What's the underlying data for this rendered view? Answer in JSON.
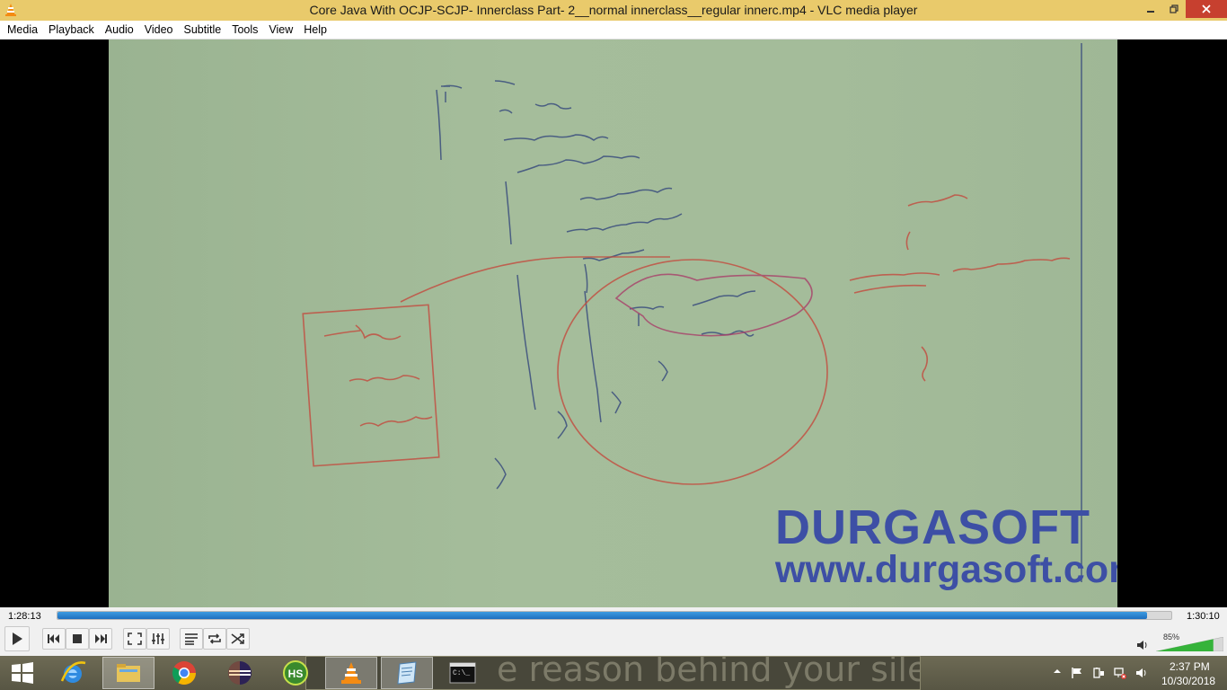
{
  "window": {
    "title": "Core Java With OCJP-SCJP- Innerclass  Part- 2__normal innerclass__regular innerc.mp4 - VLC media player",
    "controls": [
      "minimize-icon",
      "maximize-icon",
      "close-icon"
    ]
  },
  "menu": {
    "items": [
      "Media",
      "Playback",
      "Audio",
      "Video",
      "Subtitle",
      "Tools",
      "View",
      "Help"
    ]
  },
  "video": {
    "watermark_brand": "DURGASOFT",
    "watermark_url": "www.durgasoft.com"
  },
  "player": {
    "time_elapsed": "1:28:13",
    "time_total": "1:30:10",
    "progress_fraction": 0.978,
    "volume_percent": "85%",
    "volume_fraction": 0.85,
    "buttons": [
      "play",
      "previous",
      "stop",
      "next",
      "fullscreen",
      "extended-settings",
      "playlist",
      "loop",
      "random"
    ]
  },
  "taskbar": {
    "apps": [
      "start",
      "internet-explorer",
      "file-explorer",
      "chrome",
      "eclipse",
      "hs",
      "vlc",
      "notepad",
      "command-prompt"
    ],
    "active_app": "vlc",
    "ghost_text": "e reason behind your silence",
    "clock_time": "2:37 PM",
    "clock_date": "10/30/2018"
  },
  "colors": {
    "titlebar": "#e9ca6b",
    "close_button": "#c7402f",
    "whiteboard": "#a4bc9a",
    "watermark": "#3d4fa5",
    "seek_fill": "#1e6fbf",
    "taskbar": "#585644"
  }
}
